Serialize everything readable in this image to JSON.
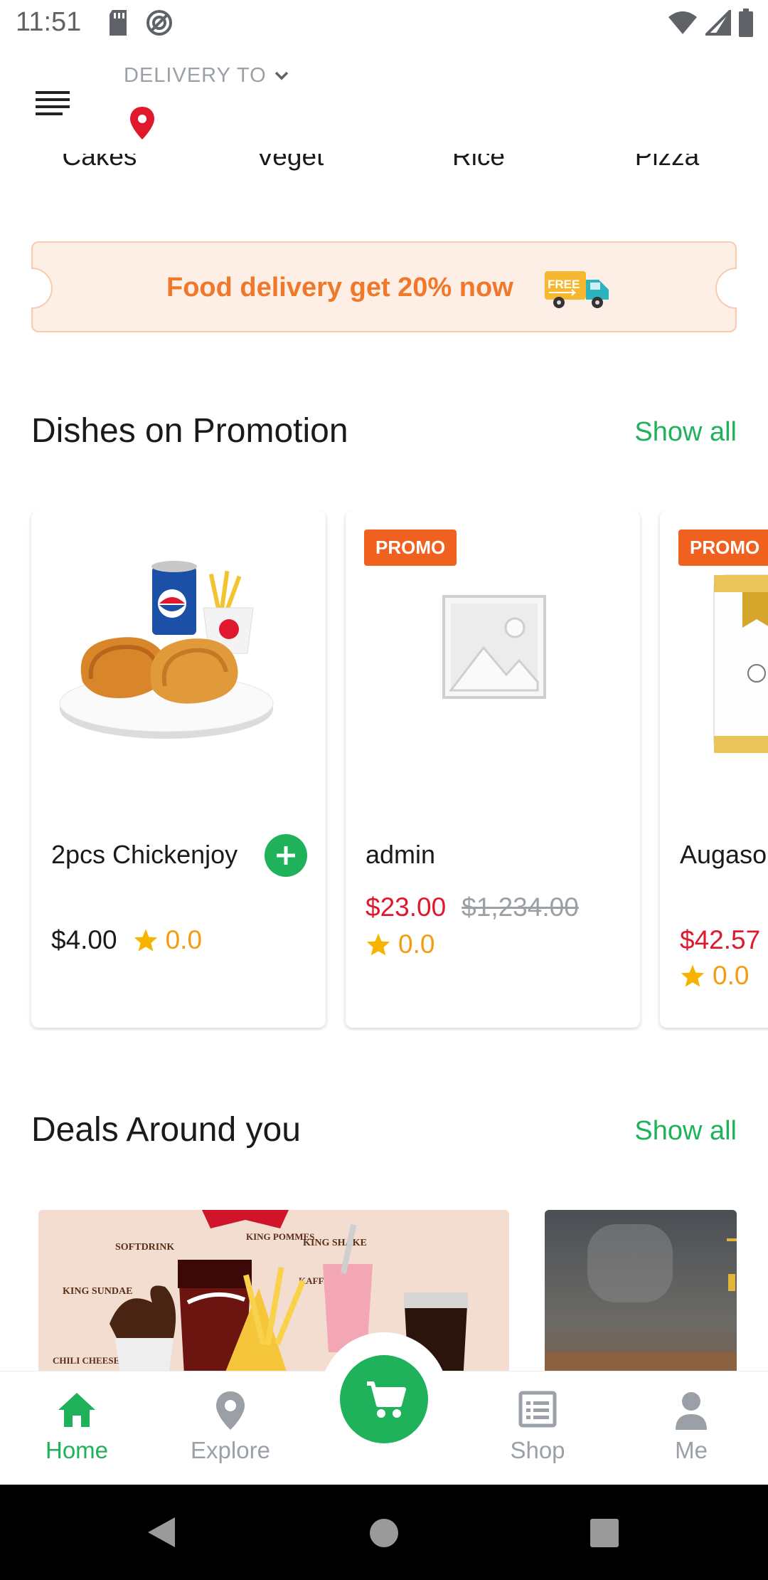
{
  "status_bar": {
    "time": "11:51"
  },
  "header": {
    "delivery_label": "DELIVERY TO"
  },
  "categories": [
    "Cakes",
    "Veget",
    "Rice",
    "Pizza"
  ],
  "banner": {
    "text": "Food delivery get 20% now",
    "truck_badge": "FREE"
  },
  "promotion_section": {
    "title": "Dishes on Promotion",
    "show_all": "Show all",
    "items": [
      {
        "name": "2pcs Chickenjoy",
        "price": "$4.00",
        "rating": "0.0"
      },
      {
        "tag": "PROMO",
        "name": "admin",
        "price": "$23.00",
        "old_price": "$1,234.00",
        "rating": "0.0"
      },
      {
        "tag": "PROMO",
        "name": "Augaso Freeze",
        "price": "$42.57",
        "rating": "0.0"
      }
    ]
  },
  "deals_section": {
    "title": "Deals Around you",
    "show_all": "Show all",
    "deal_image_words": [
      "SOFTDRINK",
      "KING POMMES",
      "KING SHAKE",
      "KING SUNDAE",
      "KAFFEE",
      "CHILI CHEESE BURGER"
    ]
  },
  "bottom_nav": {
    "items": [
      "Home",
      "Explore",
      "Shop",
      "Me"
    ],
    "active": "Home"
  },
  "colors": {
    "accent": "#1fb25a",
    "promo": "#f0611f",
    "price_red": "#e0182d",
    "star": "#f39c12",
    "banner_text": "#f0782b"
  }
}
